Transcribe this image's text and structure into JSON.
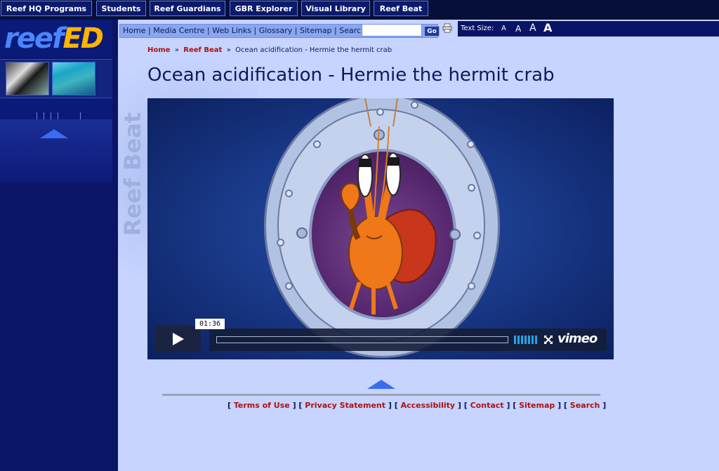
{
  "topnav": {
    "tabs": [
      "Reef HQ Programs",
      "Students",
      "Reef Guardians",
      "GBR Explorer",
      "Visual Library",
      "Reef Beat"
    ]
  },
  "logo": {
    "part1": "reef",
    "part2": "ED"
  },
  "watermark": "Reef Beat",
  "toolbar": {
    "links": [
      "Home",
      "Media Centre",
      "Web Links",
      "Glossary",
      "Sitemap"
    ],
    "separator": "|",
    "search_label": "Search:",
    "search_placeholder": "",
    "go_label": "Go",
    "text_size_label": "Text Size:",
    "text_size_options": [
      "A",
      "A",
      "A",
      "A"
    ]
  },
  "breadcrumb": {
    "items": [
      "Home",
      "Reef Beat",
      "Ocean acidification - Hermie the hermit crab"
    ],
    "separator": "»"
  },
  "page": {
    "title": "Ocean acidification - Hermie the hermit crab"
  },
  "video": {
    "time": "01:36",
    "brand": "vimeo"
  },
  "footer": {
    "links": [
      "Terms of Use",
      "Privacy Statement",
      "Accessibility",
      "Contact",
      "Sitemap",
      "Search"
    ]
  },
  "colors": {
    "background": "#c6d4ff",
    "sidebar": "#0b1566",
    "link_red": "#b01010",
    "title_navy": "#0a1a5e",
    "arrow_blue": "#3a6cf0"
  }
}
